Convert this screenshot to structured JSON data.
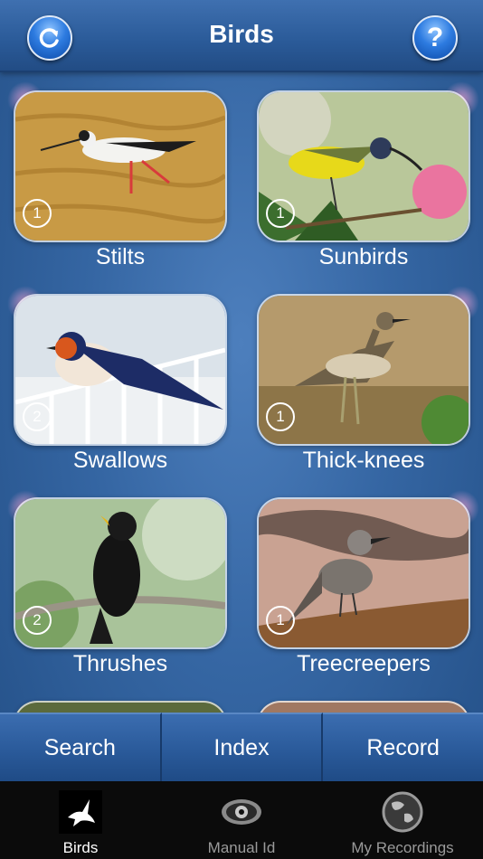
{
  "header": {
    "title": "Birds"
  },
  "buttons": {
    "refresh_icon": "refresh-icon",
    "help_label": "?"
  },
  "groups": [
    {
      "label": "Stilts",
      "count": "1"
    },
    {
      "label": "Sunbirds",
      "count": "1"
    },
    {
      "label": "Swallows",
      "count": "2"
    },
    {
      "label": "Thick-knees",
      "count": "1"
    },
    {
      "label": "Thrushes",
      "count": "2"
    },
    {
      "label": "Treecreepers",
      "count": "1"
    }
  ],
  "actions": {
    "search": "Search",
    "index": "Index",
    "record": "Record"
  },
  "tabbar": {
    "items": [
      {
        "label": "Birds",
        "icon": "bird-icon",
        "active": true
      },
      {
        "label": "Manual Id",
        "icon": "eye-icon",
        "active": false
      },
      {
        "label": "My Recordings",
        "icon": "globe-icon",
        "active": false
      }
    ]
  }
}
